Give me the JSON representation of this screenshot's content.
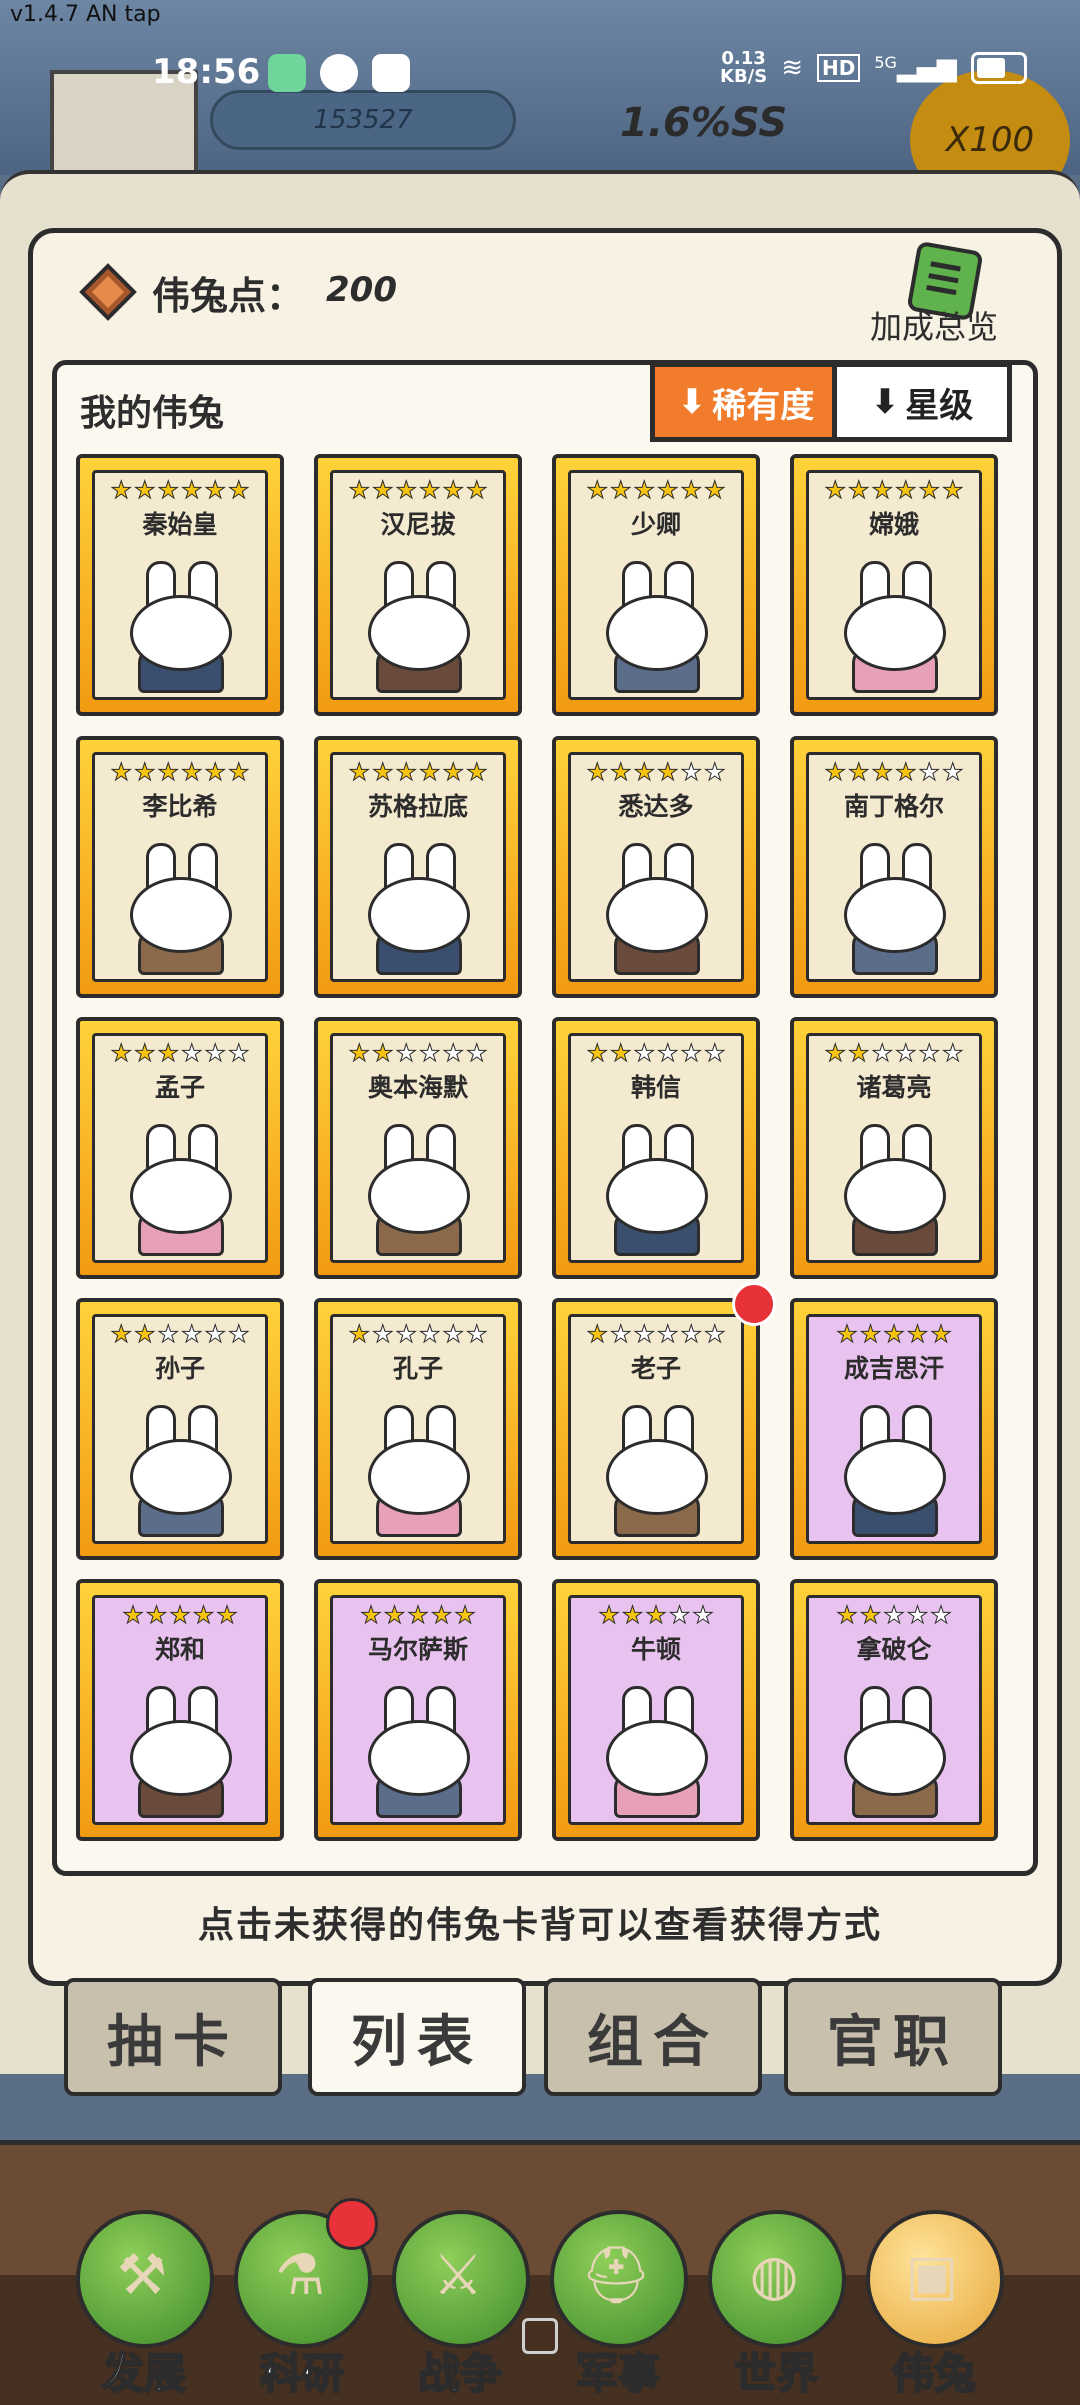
{
  "version": "v1.4.7 AN tap",
  "status_bar": {
    "time": "18:56",
    "net_speed_value": "0.13",
    "net_speed_unit": "KB/S",
    "hd": "HD",
    "signal": "5G"
  },
  "game_header": {
    "coins": "153527",
    "rate": "1.6%SS",
    "multiplier": "X100"
  },
  "points": {
    "label": "伟兔点：",
    "value": "200"
  },
  "bonus": {
    "label": "加成总览"
  },
  "list": {
    "title": "我的伟兔",
    "sort_rarity": "稀有度",
    "sort_star": "星级"
  },
  "cards": [
    {
      "name": "秦始皇",
      "stars": 6,
      "max": 6,
      "rarity": "gold"
    },
    {
      "name": "汉尼拔",
      "stars": 6,
      "max": 6,
      "rarity": "gold"
    },
    {
      "name": "少卿",
      "stars": 6,
      "max": 6,
      "rarity": "gold"
    },
    {
      "name": "嫦娥",
      "stars": 6,
      "max": 6,
      "rarity": "gold"
    },
    {
      "name": "李比希",
      "stars": 6,
      "max": 6,
      "rarity": "gold"
    },
    {
      "name": "苏格拉底",
      "stars": 6,
      "max": 6,
      "rarity": "gold"
    },
    {
      "name": "悉达多",
      "stars": 4,
      "max": 6,
      "rarity": "gold"
    },
    {
      "name": "南丁格尔",
      "stars": 4,
      "max": 6,
      "rarity": "gold"
    },
    {
      "name": "孟子",
      "stars": 3,
      "max": 6,
      "rarity": "gold"
    },
    {
      "name": "奥本海默",
      "stars": 2,
      "max": 6,
      "rarity": "gold"
    },
    {
      "name": "韩信",
      "stars": 2,
      "max": 6,
      "rarity": "gold"
    },
    {
      "name": "诸葛亮",
      "stars": 2,
      "max": 6,
      "rarity": "gold"
    },
    {
      "name": "孙子",
      "stars": 2,
      "max": 6,
      "rarity": "gold"
    },
    {
      "name": "孔子",
      "stars": 1,
      "max": 6,
      "rarity": "gold"
    },
    {
      "name": "老子",
      "stars": 1,
      "max": 6,
      "rarity": "gold"
    },
    {
      "name": "成吉思汗",
      "stars": 5,
      "max": 5,
      "rarity": "purple"
    },
    {
      "name": "郑和",
      "stars": 5,
      "max": 5,
      "rarity": "purple"
    },
    {
      "name": "马尔萨斯",
      "stars": 5,
      "max": 5,
      "rarity": "purple"
    },
    {
      "name": "牛顿",
      "stars": 3,
      "max": 5,
      "rarity": "purple"
    },
    {
      "name": "拿破仑",
      "stars": 2,
      "max": 5,
      "rarity": "purple"
    }
  ],
  "hint": "点击未获得的伟兔卡背可以查看获得方式",
  "tabs": [
    "抽卡",
    "列表",
    "组合",
    "官职"
  ],
  "active_tab": 1,
  "nav": [
    {
      "label": "发展",
      "icon": "axe-icon",
      "glyph": "⚒"
    },
    {
      "label": "科研",
      "icon": "flask-icon",
      "glyph": "⚗"
    },
    {
      "label": "战争",
      "icon": "swords-icon",
      "glyph": "⚔"
    },
    {
      "label": "军事",
      "icon": "helmet-icon",
      "glyph": "⛑"
    },
    {
      "label": "世界",
      "icon": "globe-icon",
      "glyph": "◍"
    },
    {
      "label": "伟兔",
      "icon": "card-icon",
      "glyph": "▣"
    }
  ],
  "colors": {
    "gold_card": "#f8b51e",
    "purple_card": "#e9c3ef",
    "sort_active": "#f07c2c",
    "notification": "#e8323a"
  }
}
